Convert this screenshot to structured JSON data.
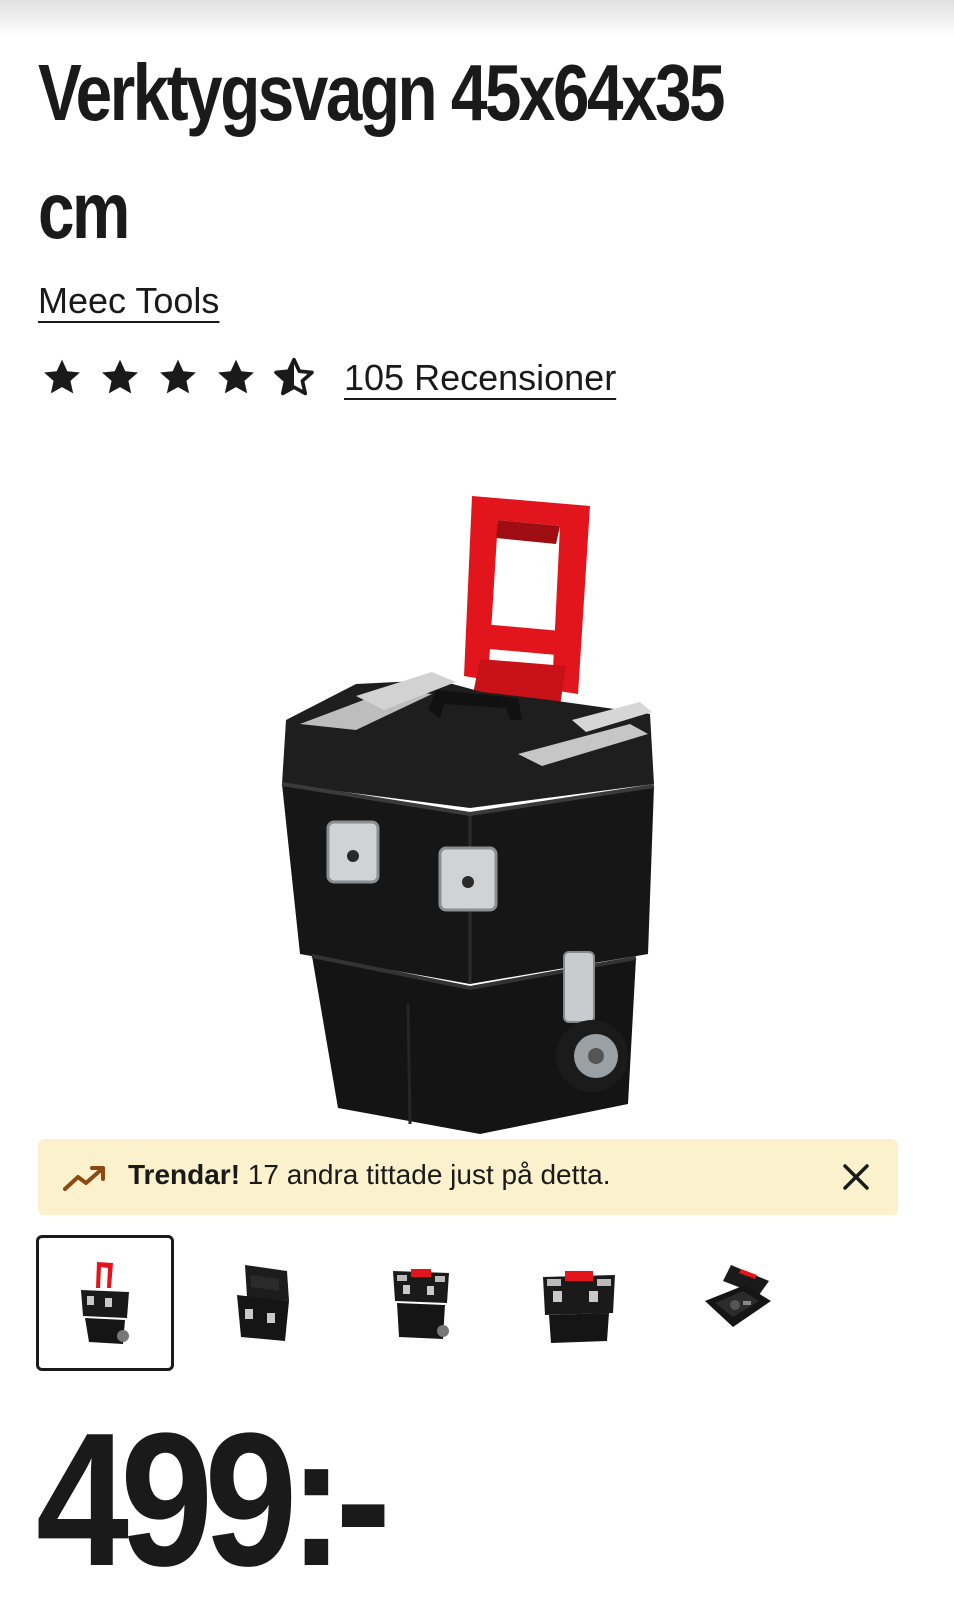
{
  "product": {
    "title": "Verktygsvagn 45x64x35 cm",
    "brand": "Meec Tools",
    "rating": 4.5,
    "rating_max": 5,
    "reviews_label": "105 Recensioner",
    "price": "499:-"
  },
  "trend_banner": {
    "icon": "trending-up-icon",
    "bold": "Trendar!",
    "text": " 17 andra tittade just på detta.",
    "close_icon": "close-icon"
  },
  "thumbnails": {
    "count": 5,
    "active_index": 0
  },
  "colors": {
    "text": "#1a1a1a",
    "banner_bg": "#fbf1cc",
    "trend_icon": "#8a4a10",
    "handle_red": "#e3151c"
  }
}
